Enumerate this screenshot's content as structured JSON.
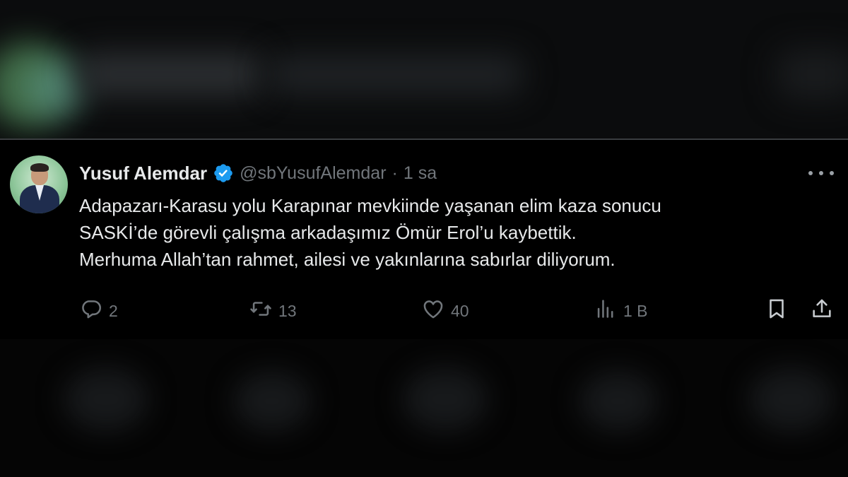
{
  "tweet": {
    "author_name": "Yusuf Alemdar",
    "handle": "@sbYusufAlemdar",
    "separator": "·",
    "time": "1 sa",
    "text_lines": [
      "Adapazarı-Karasu yolu Karapınar mevkiinde yaşanan elim kaza sonucu",
      "SASKİ’de görevli çalışma arkadaşımız Ömür Erol’u kaybettik.",
      "Merhuma Allah’tan rahmet, ailesi ve yakınlarına sabırlar diliyorum."
    ],
    "counts": {
      "replies": "2",
      "retweets": "13",
      "likes": "40",
      "views": "1 B"
    },
    "icons": {
      "verified": "verified-badge-icon",
      "more": "more-dots-icon",
      "reply": "reply-icon",
      "retweet": "retweet-icon",
      "like": "heart-icon",
      "views": "views-icon",
      "bookmark": "bookmark-icon",
      "share": "share-icon"
    }
  },
  "colors": {
    "background": "#000000",
    "text_primary": "#e7e9ea",
    "text_secondary": "#71767b",
    "verified_blue": "#1d9bf0"
  }
}
